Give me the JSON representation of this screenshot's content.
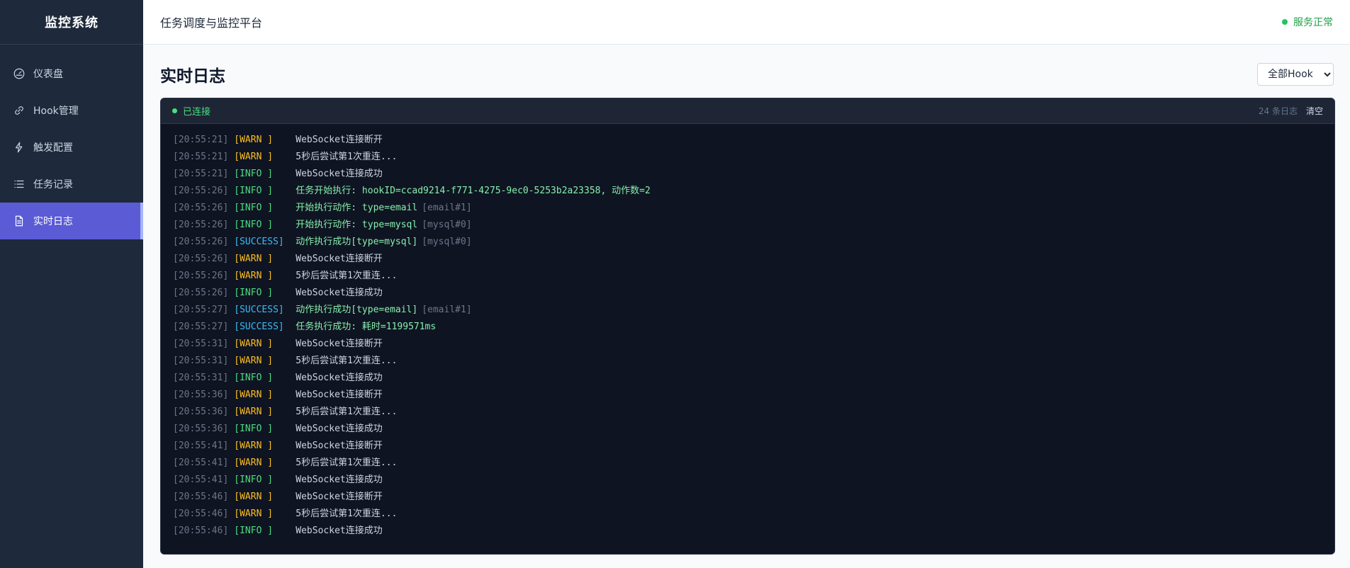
{
  "sidebar": {
    "brand": "监控系统",
    "items": [
      {
        "label": "仪表盘",
        "icon": "gauge-icon"
      },
      {
        "label": "Hook管理",
        "icon": "link-icon"
      },
      {
        "label": "触发配置",
        "icon": "lightning-icon"
      },
      {
        "label": "任务记录",
        "icon": "list-icon"
      },
      {
        "label": "实时日志",
        "icon": "document-icon",
        "active": true
      }
    ]
  },
  "topbar": {
    "title": "任务调度与监控平台",
    "status": "服务正常"
  },
  "page": {
    "title": "实时日志",
    "hook_filter": {
      "selected": "全部Hook"
    }
  },
  "log_panel": {
    "connection": "已连接",
    "count": "24 条日志",
    "clear_label": "清空",
    "lines": [
      {
        "ts": "[20:55:21]",
        "level": "WARN",
        "label": "[WARN ]",
        "msg": "WebSocket连接断开",
        "tag": ""
      },
      {
        "ts": "[20:55:21]",
        "level": "WARN",
        "label": "[WARN ]",
        "msg": "5秒后尝试第1次重连...",
        "tag": ""
      },
      {
        "ts": "[20:55:21]",
        "level": "INFO",
        "label": "[INFO ]",
        "msg": "WebSocket连接成功",
        "tag": ""
      },
      {
        "ts": "[20:55:26]",
        "level": "INFO",
        "label": "[INFO ]",
        "msg": "任务开始执行: hookID=ccad9214-f771-4275-9ec0-5253b2a23358, 动作数=2",
        "tag": "",
        "highlight": true
      },
      {
        "ts": "[20:55:26]",
        "level": "INFO",
        "label": "[INFO ]",
        "msg": "开始执行动作: type=email",
        "tag": "[email#1]",
        "highlight": true
      },
      {
        "ts": "[20:55:26]",
        "level": "INFO",
        "label": "[INFO ]",
        "msg": "开始执行动作: type=mysql",
        "tag": "[mysql#0]",
        "highlight": true
      },
      {
        "ts": "[20:55:26]",
        "level": "SUCCESS",
        "label": "[SUCCESS]",
        "msg": "动作执行成功[type=mysql]",
        "tag": "[mysql#0]",
        "highlight": true
      },
      {
        "ts": "[20:55:26]",
        "level": "WARN",
        "label": "[WARN ]",
        "msg": "WebSocket连接断开",
        "tag": ""
      },
      {
        "ts": "[20:55:26]",
        "level": "WARN",
        "label": "[WARN ]",
        "msg": "5秒后尝试第1次重连...",
        "tag": ""
      },
      {
        "ts": "[20:55:26]",
        "level": "INFO",
        "label": "[INFO ]",
        "msg": "WebSocket连接成功",
        "tag": ""
      },
      {
        "ts": "[20:55:27]",
        "level": "SUCCESS",
        "label": "[SUCCESS]",
        "msg": "动作执行成功[type=email]",
        "tag": "[email#1]",
        "highlight": true
      },
      {
        "ts": "[20:55:27]",
        "level": "SUCCESS",
        "label": "[SUCCESS]",
        "msg": "任务执行成功: 耗时=1199571ms",
        "tag": "",
        "highlight": true
      },
      {
        "ts": "[20:55:31]",
        "level": "WARN",
        "label": "[WARN ]",
        "msg": "WebSocket连接断开",
        "tag": ""
      },
      {
        "ts": "[20:55:31]",
        "level": "WARN",
        "label": "[WARN ]",
        "msg": "5秒后尝试第1次重连...",
        "tag": ""
      },
      {
        "ts": "[20:55:31]",
        "level": "INFO",
        "label": "[INFO ]",
        "msg": "WebSocket连接成功",
        "tag": ""
      },
      {
        "ts": "[20:55:36]",
        "level": "WARN",
        "label": "[WARN ]",
        "msg": "WebSocket连接断开",
        "tag": ""
      },
      {
        "ts": "[20:55:36]",
        "level": "WARN",
        "label": "[WARN ]",
        "msg": "5秒后尝试第1次重连...",
        "tag": ""
      },
      {
        "ts": "[20:55:36]",
        "level": "INFO",
        "label": "[INFO ]",
        "msg": "WebSocket连接成功",
        "tag": ""
      },
      {
        "ts": "[20:55:41]",
        "level": "WARN",
        "label": "[WARN ]",
        "msg": "WebSocket连接断开",
        "tag": ""
      },
      {
        "ts": "[20:55:41]",
        "level": "WARN",
        "label": "[WARN ]",
        "msg": "5秒后尝试第1次重连...",
        "tag": ""
      },
      {
        "ts": "[20:55:41]",
        "level": "INFO",
        "label": "[INFO ]",
        "msg": "WebSocket连接成功",
        "tag": ""
      },
      {
        "ts": "[20:55:46]",
        "level": "WARN",
        "label": "[WARN ]",
        "msg": "WebSocket连接断开",
        "tag": ""
      },
      {
        "ts": "[20:55:46]",
        "level": "WARN",
        "label": "[WARN ]",
        "msg": "5秒后尝试第1次重连...",
        "tag": ""
      },
      {
        "ts": "[20:55:46]",
        "level": "INFO",
        "label": "[INFO ]",
        "msg": "WebSocket连接成功",
        "tag": ""
      }
    ]
  },
  "colors": {
    "sidebar_bg": "#1e293b",
    "active_nav": "#5b5bd6",
    "log_bg": "#0f1422",
    "warn": "#fbbf24",
    "info": "#4ade80",
    "success": "#38bdf8",
    "status_ok": "#22c55e"
  }
}
